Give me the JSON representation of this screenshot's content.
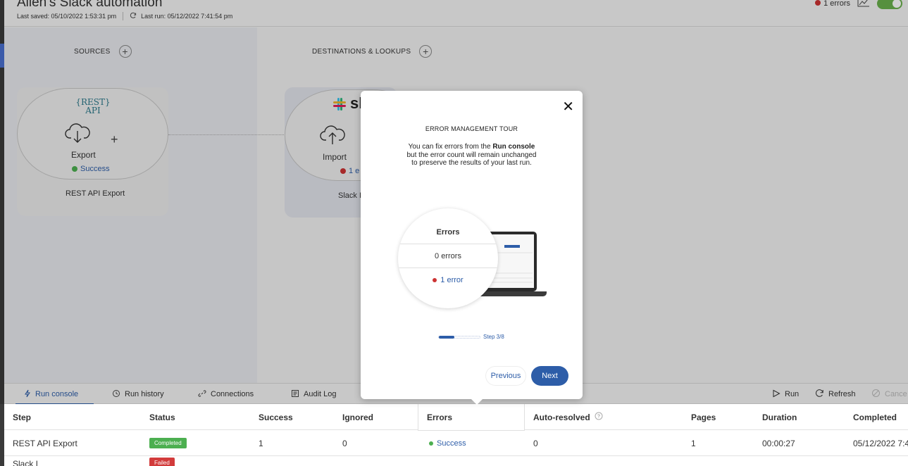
{
  "header": {
    "title": "Allen's Slack automation",
    "last_saved": "Last saved: 05/10/2022 1:53:31 pm",
    "last_run": "Last run: 05/12/2022 7:41:54 pm",
    "errors_label": "1 errors"
  },
  "canvas": {
    "sources_title": "SOURCES",
    "destinations_title": "DESTINATIONS & LOOKUPS",
    "source": {
      "logo_line1": "{REST}",
      "logo_line2": "API",
      "action": "Export",
      "status": "Success",
      "name": "REST API Export"
    },
    "destination": {
      "logo": "sl",
      "action": "Import",
      "status": "1 e",
      "name": "Slack I"
    }
  },
  "tabs": {
    "run_console": "Run console",
    "run_history": "Run history",
    "connections": "Connections",
    "audit_log": "Audit Log"
  },
  "actions": {
    "run": "Run",
    "refresh": "Refresh",
    "cancel": "Cance"
  },
  "table": {
    "headers": {
      "step": "Step",
      "status": "Status",
      "success": "Success",
      "ignored": "Ignored",
      "errors": "Errors",
      "auto_resolved": "Auto-resolved",
      "pages": "Pages",
      "duration": "Duration",
      "completed": "Completed"
    },
    "rows": [
      {
        "step": "REST API Export",
        "status": "Completed",
        "success": "1",
        "ignored": "0",
        "errors": "Success",
        "auto_resolved": "0",
        "pages": "1",
        "duration": "00:00:27",
        "completed": "05/12/2022 7:4"
      },
      {
        "step": "Slack I",
        "status": "Failed"
      }
    ]
  },
  "tour": {
    "title": "ERROR MANAGEMENT TOUR",
    "body_pre": "You can fix errors from the",
    "body_bold": "Run console",
    "body_post": "but the error count will remain unchanged to preserve the results of your last run.",
    "illus_header": "Errors",
    "illus_zero": "0 errors",
    "illus_one": "1 error",
    "step": "Step 3/8",
    "step_progress": 0.375,
    "previous": "Previous",
    "next": "Next"
  },
  "colors": {
    "accent": "#2d5da8",
    "success": "#4caf50",
    "error": "#d23b3b"
  }
}
